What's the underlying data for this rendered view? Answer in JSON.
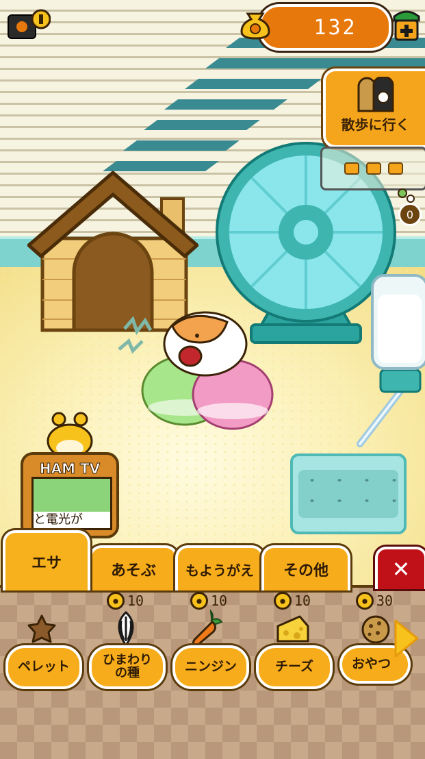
{
  "hud": {
    "coin_count": "132",
    "camera_icon": "camera-icon",
    "shop_icon": "shop-icon"
  },
  "walk": {
    "label": "散歩に行く",
    "progress_dots": 3,
    "counter_badge": "0"
  },
  "tv": {
    "title": "HAM TV",
    "ticker": "と電光が"
  },
  "tabs": [
    {
      "label": "エサ",
      "active": true
    },
    {
      "label": "あそぶ",
      "active": false
    },
    {
      "label": "もようがえ",
      "active": false
    },
    {
      "label": "その他",
      "active": false
    }
  ],
  "items": [
    {
      "label": "ペレット",
      "price": "",
      "icon": "pellet-icon"
    },
    {
      "label": "ひまわり\nの種",
      "price": "10",
      "icon": "sunflower-seed-icon"
    },
    {
      "label": "ニンジン",
      "price": "10",
      "icon": "carrot-icon"
    },
    {
      "label": "チーズ",
      "price": "10",
      "icon": "cheese-icon"
    },
    {
      "label": "おやつ",
      "price": "30",
      "icon": "cookie-icon"
    }
  ],
  "colors": {
    "accent_orange": "#f7ad1b",
    "coin_pill": "#e7780c",
    "close_red": "#c01018",
    "wheel_teal": "#3fb5b0"
  }
}
